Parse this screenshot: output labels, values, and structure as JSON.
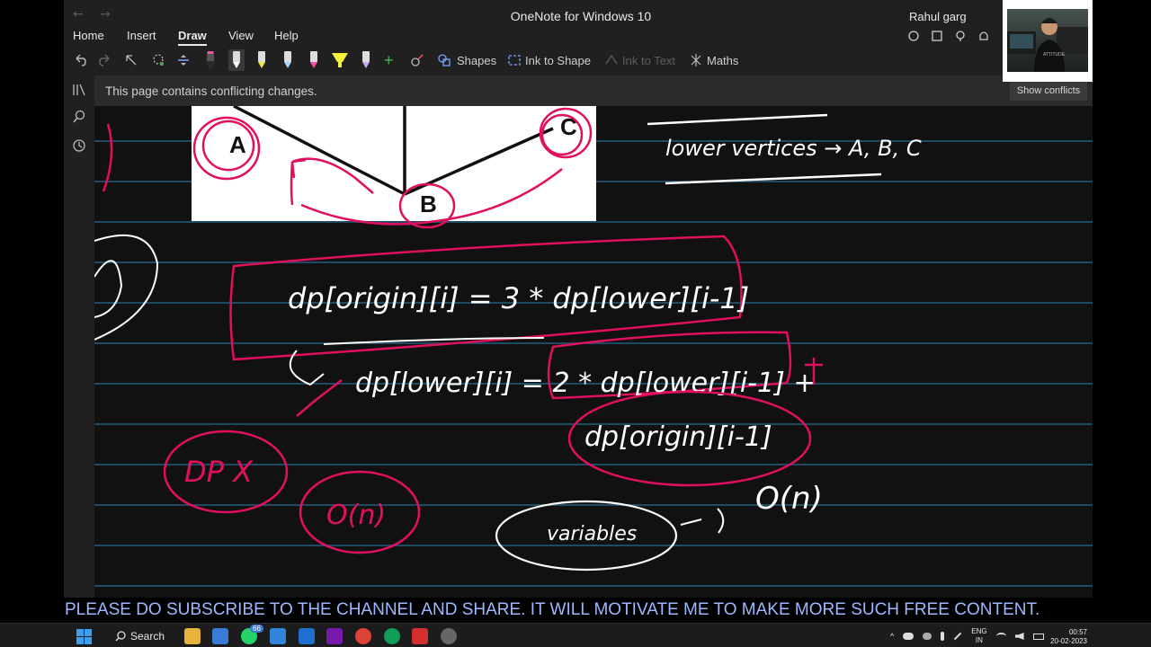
{
  "window": {
    "title": "OneNote for Windows 10",
    "user": "Rahul garg"
  },
  "menu": {
    "items": [
      "Home",
      "Insert",
      "Draw",
      "View",
      "Help"
    ],
    "active": "Draw"
  },
  "toolbar": {
    "shapes_label": "Shapes",
    "ink_to_shape_label": "Ink to Shape",
    "ink_to_text_label": "Ink to Text",
    "maths_label": "Maths",
    "pens": [
      {
        "name": "pen-dark",
        "color": "#2a2a2a"
      },
      {
        "name": "pen-white",
        "color": "#ffffff"
      },
      {
        "name": "pen-yellow",
        "color": "#f2e34a"
      },
      {
        "name": "pen-lightblue",
        "color": "#a8d8ff"
      },
      {
        "name": "pen-pink",
        "color": "#ff4fa3"
      },
      {
        "name": "highlighter-yellow",
        "color": "#f5f03a"
      },
      {
        "name": "pen-purple",
        "color": "#c9a6ff"
      }
    ]
  },
  "notice": {
    "text": "This page contains conflicting changes.",
    "button": "Show conflicts"
  },
  "banner": {
    "text": "PLEASE DO SUBSCRIBE TO THE CHANNEL AND SHARE. IT WILL MOTIVATE ME TO MAKE MORE SUCH FREE CONTENT."
  },
  "taskbar": {
    "search_label": "Search",
    "whatsapp_badge": "66",
    "lang": "ENG",
    "region": "IN",
    "time": "00:57",
    "date": "20-02-2023"
  },
  "colors": {
    "ink_pink": "#e0105e",
    "ink_white": "#ffffff",
    "rule_lines": "#1f4a63",
    "banner_text": "#9db8ff"
  },
  "diagram": {
    "nodes": [
      "A",
      "B",
      "C"
    ]
  },
  "handwriting": {
    "top_note": "lower vertices → A, B, C",
    "eq1": "dp[origin][i] = 3 * dp[lower][i-1]",
    "eq2": "dp[lower][i] = 2 * dp[lower][i-1] +",
    "eq2_cont": "dp[origin][i-1]",
    "dp_x": "DP X",
    "on_left": "O(n)",
    "variables": "variables",
    "on_right": "O(n)"
  }
}
